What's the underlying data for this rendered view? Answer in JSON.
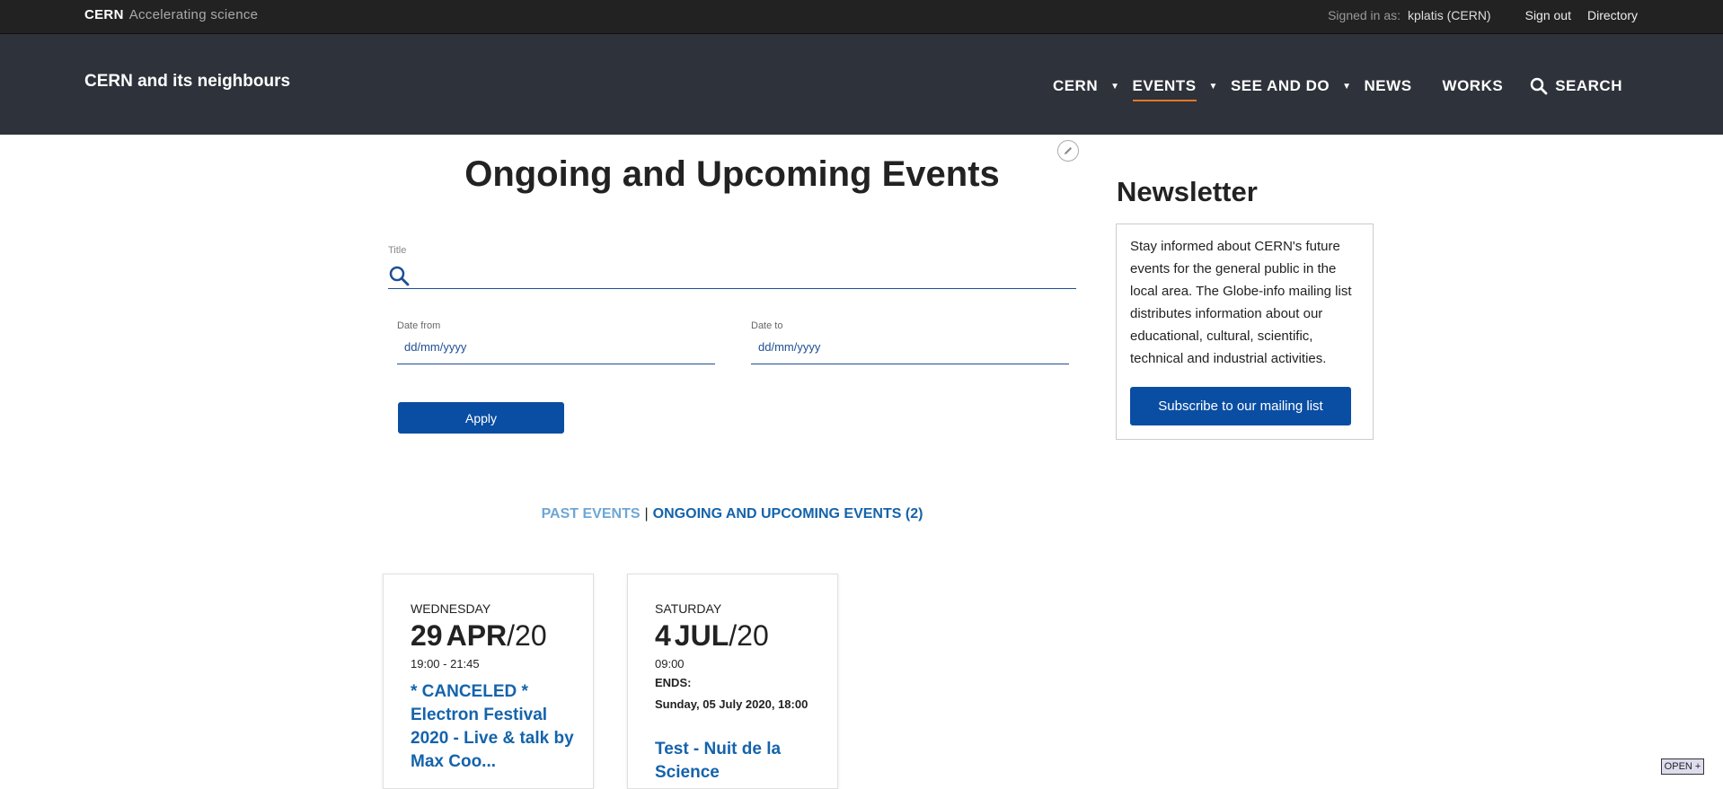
{
  "toolbar": {
    "brand": "CERN",
    "tagline": "Accelerating science",
    "signed_in_label": "Signed in as:",
    "user": "kplatis (CERN)",
    "sign_out": "Sign out",
    "directory": "Directory"
  },
  "header": {
    "site_title": "CERN and its neighbours",
    "nav": [
      {
        "label": "CERN",
        "dropdown": true
      },
      {
        "label": "EVENTS",
        "dropdown": true,
        "active": true
      },
      {
        "label": "SEE AND DO",
        "dropdown": true
      },
      {
        "label": "NEWS",
        "dropdown": false
      },
      {
        "label": "WORKS",
        "dropdown": false
      },
      {
        "label": "SEARCH",
        "icon": "search-icon"
      }
    ]
  },
  "main": {
    "title": "Ongoing and Upcoming Events",
    "filters": {
      "title_label": "Title",
      "title_value": "",
      "date_from_label": "Date from",
      "date_from_placeholder": "dd/mm/yyyy",
      "date_to_label": "Date to",
      "date_to_placeholder": "dd/mm/yyyy",
      "apply_label": "Apply"
    },
    "tabs": {
      "past": "PAST EVENTS",
      "separator": "|",
      "ongoing": "ONGOING AND UPCOMING EVENTS (2)"
    },
    "events": [
      {
        "weekday": "WEDNESDAY",
        "day": "29",
        "month": "APR",
        "year": "/20",
        "time": "19:00 - 21:45",
        "title": "* CANCELED * Electron Festival 2020 - Live & talk by Max Coo..."
      },
      {
        "weekday": "SATURDAY",
        "day": "4",
        "month": "JUL",
        "year": "/20",
        "time": "09:00",
        "ends_label": "ENDS:",
        "ends_value": "Sunday, 05 July 2020, 18:00",
        "title": "Test - Nuit de la Science"
      }
    ]
  },
  "newsletter": {
    "title": "Newsletter",
    "text": "Stay informed about CERN's future events for the general public in the local area. The Globe-info mailing list distributes information about our educational, cultural, scientific, technical and industrial activities.",
    "button": "Subscribe to our mailing list"
  },
  "open_button": "OPEN +",
  "colors": {
    "toolbar_bg": "#222222",
    "header_bg": "#2e323a",
    "accent": "#0a4ea3",
    "link": "#1463ab",
    "active_underline": "#e87722"
  }
}
